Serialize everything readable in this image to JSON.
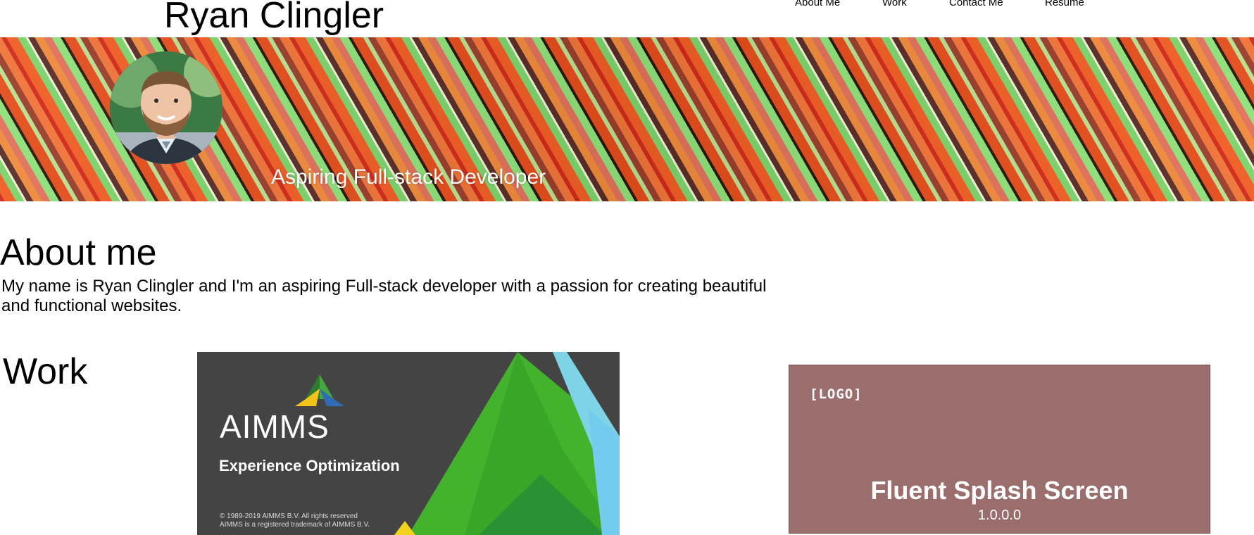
{
  "header": {
    "site_name": "Ryan Clingler",
    "nav": [
      {
        "label": "About Me"
      },
      {
        "label": "Work"
      },
      {
        "label": "Contact Me"
      },
      {
        "label": "Resume"
      }
    ]
  },
  "hero": {
    "tagline": "Aspiring Full-stack Developer",
    "colors": [
      "#d02a1a",
      "#f05d24",
      "#7dd36b",
      "#5a2d27",
      "#ef8a3c",
      "#e0715c"
    ]
  },
  "about": {
    "title": "About me",
    "text": "My name is Ryan Clingler and I'm an aspiring Full-stack developer with a passion for creating beautiful and functional websites."
  },
  "work": {
    "title": "Work",
    "projects": [
      {
        "name": "AIMMS",
        "tagline": "Experience Optimization",
        "copyright_line1": "© 1989-2019 AIMMS B.V. All rights reserved",
        "copyright_line2": "AIMMS is a registered trademark of AIMMS B.V.",
        "icon": "aimms-triangle-logo-icon",
        "background": "#444444"
      },
      {
        "logo_text": "[LOGO]",
        "title": "Fluent Splash Screen",
        "version": "1.0.0.0",
        "background": "#9b6e6e"
      }
    ]
  }
}
